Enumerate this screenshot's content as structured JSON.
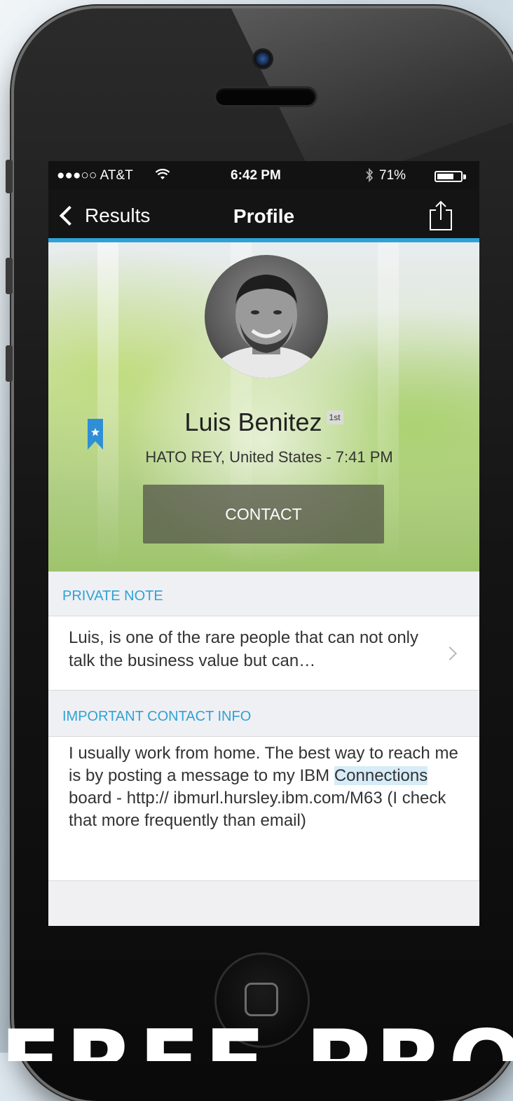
{
  "status_bar": {
    "carrier": "●●●○○ AT&T",
    "time": "6:42 PM",
    "battery_percent_text": "71%",
    "battery_level": 0.71
  },
  "nav": {
    "back_label": "Results",
    "title": "Profile"
  },
  "profile": {
    "name": "Luis Benitez",
    "degree_badge": "1st",
    "location": "HATO REY, United States - 7:41 PM",
    "contact_button": "CONTACT"
  },
  "sections": {
    "private_note": {
      "title": "PRIVATE NOTE",
      "text": "Luis, is one of the rare people that can not only talk the business value but can…"
    },
    "important_contact_info": {
      "title": "IMPORTANT CONTACT INFO",
      "text_before": "I usually work from home. The best way to reach me is by posting a message to my IBM ",
      "text_highlight": "Connections",
      "text_after": " board - http:// ibmurl.hursley.ibm.com/M63 (I check that more frequently than email)"
    }
  },
  "footer_caption": "FREE PROFILE",
  "colors": {
    "accent_blue": "#2ea2d6",
    "nav_background": "#141414",
    "bookmark_blue": "#2f8fd6"
  },
  "icons": [
    "wifi-icon",
    "bluetooth-icon",
    "battery-icon",
    "back-chevron-icon",
    "share-icon",
    "bookmark-star-icon",
    "chevron-right-icon"
  ]
}
